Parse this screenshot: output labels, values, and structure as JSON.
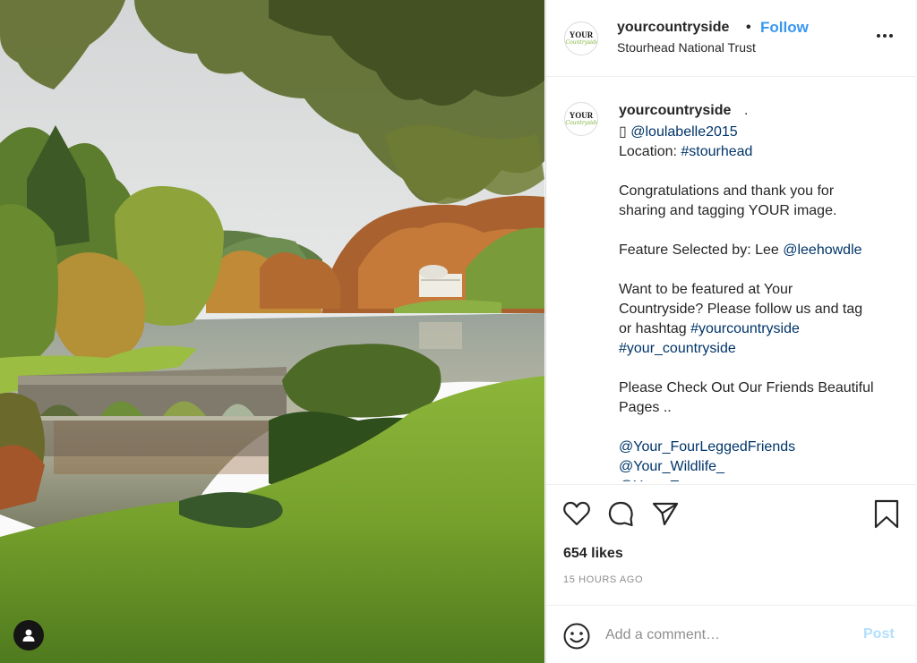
{
  "post": {
    "username": "yourcountryside",
    "location": "Stourhead National Trust",
    "follow_label": "Follow",
    "header_separator": "•",
    "avatar_logo": {
      "top": "YOUR",
      "script": "Countryside"
    },
    "colors": {
      "follow": "#3897f0",
      "link": "#003569",
      "post_disabled": "#b2dffc"
    }
  },
  "caption": {
    "username": "yourcountryside",
    "trailing": ".",
    "lines": [
      {
        "prefix": "▯ ",
        "link": "@loulabelle2015",
        "text": ""
      },
      {
        "prefix": "Location: ",
        "link": "#stourhead",
        "text": ""
      },
      {
        "gap": true
      },
      {
        "prefix": "Congratulations and thank you for",
        "link": "",
        "text": ""
      },
      {
        "prefix": "sharing and tagging YOUR image.",
        "link": "",
        "text": ""
      },
      {
        "gap": true
      },
      {
        "prefix": "Feature Selected by: Lee ",
        "link": "@leehowdle",
        "text": ""
      },
      {
        "gap": true
      },
      {
        "prefix": "Want to be featured at Your",
        "link": "",
        "text": ""
      },
      {
        "prefix": "Countryside? Please follow us and tag",
        "link": "",
        "text": ""
      },
      {
        "prefix": "or hashtag ",
        "link": "#yourcountryside",
        "text": ""
      },
      {
        "prefix": "",
        "link": "#your_countryside",
        "text": ""
      },
      {
        "gap": true
      },
      {
        "prefix": "Please Check Out Our Friends Beautiful",
        "link": "",
        "text": ""
      },
      {
        "prefix": "Pages ..",
        "link": "",
        "text": ""
      },
      {
        "gap": true
      },
      {
        "prefix": "",
        "link": "@Your_FourLeggedFriends",
        "text": ""
      },
      {
        "prefix": "",
        "link": "@Your_Wildlife_",
        "text": ""
      },
      {
        "prefix": "",
        "link": "@Your_Towns",
        "text": ""
      }
    ]
  },
  "actions": {
    "icons": [
      "heart-icon",
      "comment-icon",
      "share-icon",
      "bookmark-icon"
    ]
  },
  "likes_text": "654 likes",
  "timestamp": "15 HOURS AGO",
  "comment_box": {
    "placeholder": "Add a comment…",
    "post_label": "Post",
    "emoji_icon": "emoji-icon"
  },
  "photo": {
    "subject": "Stourhead landscape",
    "user_tag_icon": "user-icon"
  }
}
